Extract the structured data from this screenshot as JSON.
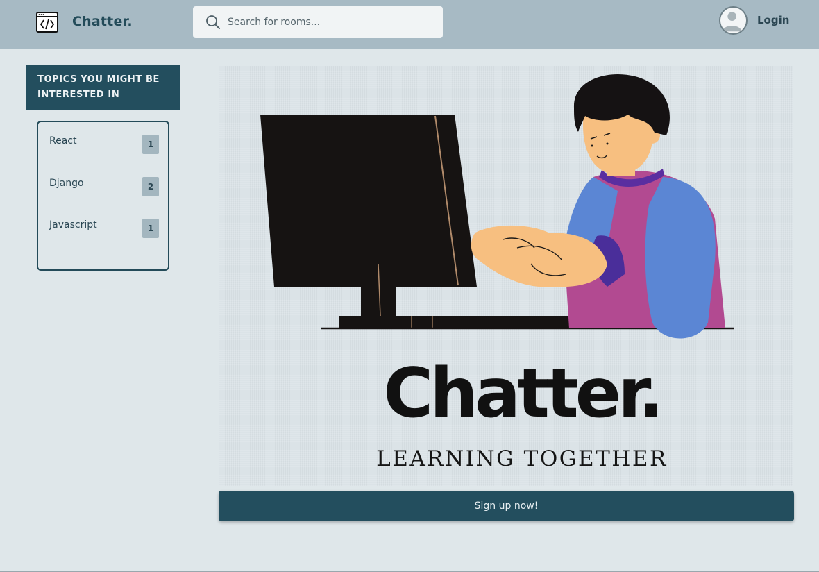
{
  "header": {
    "brand": "Chatter.",
    "search_placeholder": "Search for rooms...",
    "login_label": "Login"
  },
  "sidebar": {
    "title": "TOPICS YOU MIGHT BE INTERESTED IN",
    "topics": [
      {
        "label": "React",
        "count": "1"
      },
      {
        "label": "Django",
        "count": "2"
      },
      {
        "label": "Javascript",
        "count": "1"
      }
    ]
  },
  "hero": {
    "title": "Chatter.",
    "tagline": "LEARNING TOGETHER"
  },
  "cta": {
    "label": "Sign up now!"
  },
  "colors": {
    "header_bg": "#a7bac4",
    "accent": "#234e5e",
    "page_bg": "#dfe7ea",
    "badge": "#a3b6bf"
  }
}
